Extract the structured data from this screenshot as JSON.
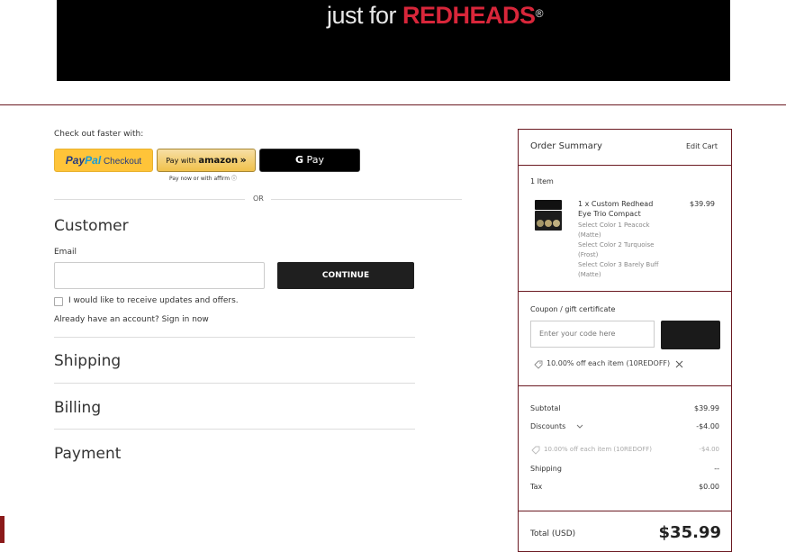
{
  "header": {
    "logo_part1": "just for ",
    "logo_part2": "REDHEADS",
    "logo_reg": "®"
  },
  "express": {
    "title": "Check out faster with:",
    "paypal": {
      "brand1": "Pay",
      "brand2": "Pal",
      "label": " Checkout"
    },
    "amazon": {
      "prefix": "Pay with ",
      "brand": "amazon",
      "chevrons": "»",
      "sub": "Pay now or with affirm ⓘ"
    },
    "gpay": {
      "g": "G",
      "label": " Pay"
    },
    "or": "OR"
  },
  "customer": {
    "heading": "Customer",
    "email_label": "Email",
    "email_value": "",
    "continue_label": "CONTINUE",
    "updates_label": "I would like to receive updates and offers.",
    "signin_prefix": "Already have an account? ",
    "signin_link": "Sign in now"
  },
  "sections": {
    "shipping": "Shipping",
    "billing": "Billing",
    "payment": "Payment"
  },
  "summary": {
    "title": "Order Summary",
    "edit": "Edit Cart",
    "item_count": "1 Item",
    "item": {
      "name_line1": "1 x Custom Redhead",
      "name_line2": "Eye Trio Compact",
      "price": "$39.99",
      "opt1a": "Select Color 1 Peacock",
      "opt1b": "(Matte)",
      "opt2a": "Select Color 2 Turquoise",
      "opt2b": "(Frost)",
      "opt3a": "Select Color 3 Barely Buff",
      "opt3b": "(Matte)"
    },
    "coupon_label": "Coupon / gift certificate",
    "coupon_placeholder": "Enter your code here",
    "applied_coupon": "10.00% off each item (10REDOFF)",
    "subtotal_label": "Subtotal",
    "subtotal": "$39.99",
    "discounts_label": "Discounts",
    "discounts": "-$4.00",
    "discount_detail": "10.00% off each item (10REDOFF)",
    "discount_detail_amt": "-$4.00",
    "shipping_label": "Shipping",
    "shipping": "--",
    "tax_label": "Tax",
    "tax": "$0.00",
    "total_label": "Total (USD)",
    "total": "$35.99"
  },
  "colors": {
    "accent": "#6b1a22",
    "paypal_yellow": "#ffc439",
    "amazon_gold": "#f0c14b"
  }
}
